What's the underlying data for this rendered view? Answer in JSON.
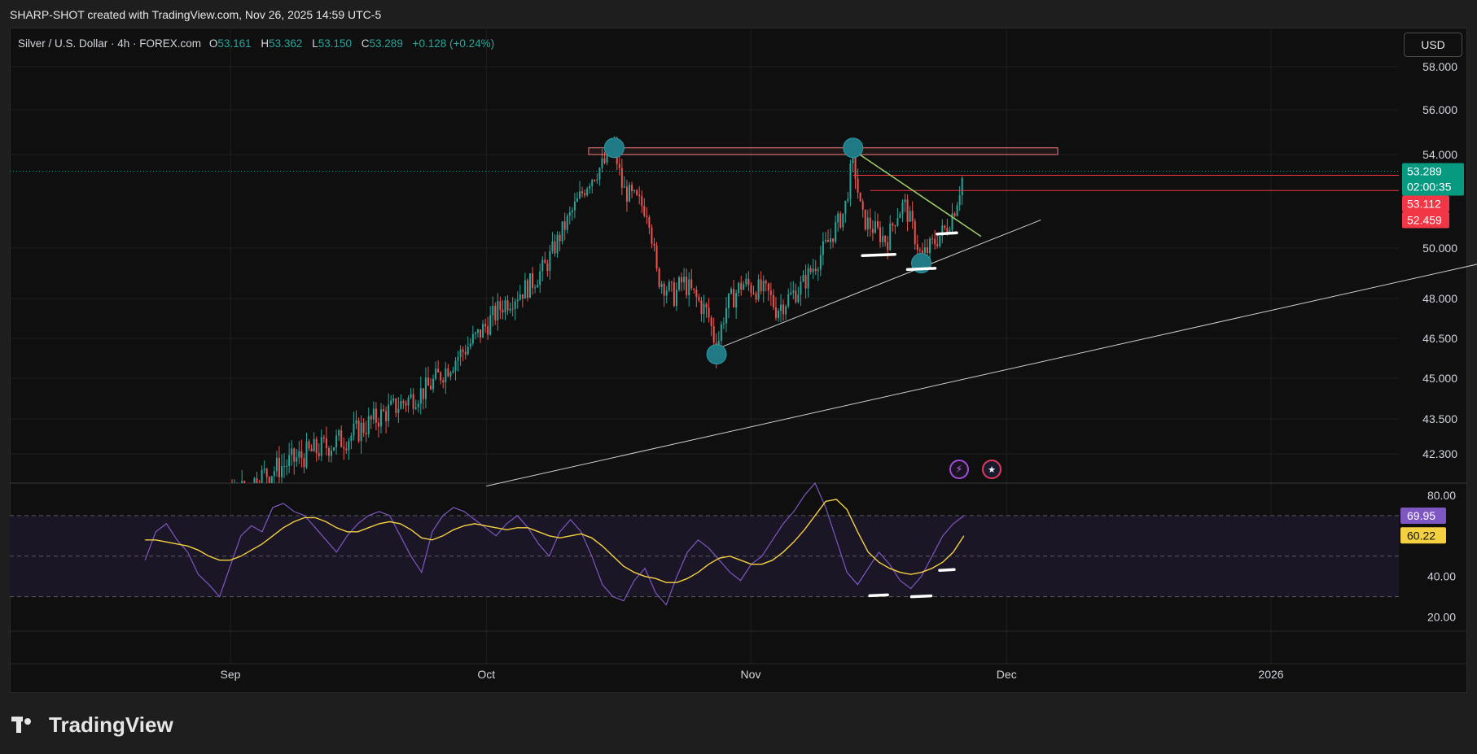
{
  "header": {
    "attribution": "SHARP-SHOT created with TradingView.com, Nov 26, 2025 14:59 UTC-5"
  },
  "legend": {
    "symbol": "Silver / U.S. Dollar · 4h · FOREX.com",
    "o_label": "O",
    "o_value": "53.161",
    "h_label": "H",
    "h_value": "53.362",
    "l_label": "L",
    "l_value": "53.150",
    "c_label": "C",
    "c_value": "53.289",
    "change": "+0.128 (+0.24%)"
  },
  "currency_button": "USD",
  "footer": {
    "brand": "TradingView"
  },
  "colors": {
    "bull": "#26a69a",
    "bear": "#ef5350",
    "rsi": "#7e57c2",
    "rsi_ma": "#f5d142",
    "resistance": "#f77c80",
    "price_badge": "#089981",
    "level_badge": "#f23645"
  },
  "icons": [
    "lightning-icon",
    "us-flag-icon"
  ],
  "chart_data": [
    {
      "type": "candlestick",
      "title": "Silver / U.S. Dollar",
      "timeframe": "4h",
      "x_ticks": [
        "Sep",
        "Oct",
        "Nov",
        "Dec",
        "2026"
      ],
      "y_ticks": [
        "58.000",
        "56.000",
        "54.000",
        "50.000",
        "48.000",
        "46.500",
        "45.000",
        "43.500",
        "42.300"
      ],
      "ylim": [
        41.5,
        58.5
      ],
      "price_path": [
        [
          "Aug 22",
          39.2
        ],
        [
          "Aug 29",
          39.6
        ],
        [
          "Sep 1",
          40.8
        ],
        [
          "Sep 5",
          41.6
        ],
        [
          "Sep 10",
          42.3
        ],
        [
          "Sep 15",
          42.9
        ],
        [
          "Sep 19",
          43.7
        ],
        [
          "Sep 24",
          44.6
        ],
        [
          "Sep 30",
          46.6
        ],
        [
          "Oct 3",
          47.8
        ],
        [
          "Oct 6",
          48.5
        ],
        [
          "Oct 8",
          49.3
        ],
        [
          "Oct 10",
          50.8
        ],
        [
          "Oct 13",
          52.9
        ],
        [
          "Oct 15",
          53.7
        ],
        [
          "Oct 16",
          54.3
        ],
        [
          "Oct 17",
          52.5
        ],
        [
          "Oct 20",
          51.6
        ],
        [
          "Oct 21",
          48.9
        ],
        [
          "Oct 23",
          48.1
        ],
        [
          "Oct 24",
          48.7
        ],
        [
          "Oct 27",
          47.4
        ],
        [
          "Oct 28",
          46.1
        ],
        [
          "Oct 29",
          47.6
        ],
        [
          "Oct 31",
          48.6
        ],
        [
          "Nov 3",
          48.2
        ],
        [
          "Nov 4",
          47.6
        ],
        [
          "Nov 6",
          48.2
        ],
        [
          "Nov 7",
          48.5
        ],
        [
          "Nov 10",
          50.2
        ],
        [
          "Nov 12",
          51.6
        ],
        [
          "Nov 13",
          53.9
        ],
        [
          "Nov 14",
          51.3
        ],
        [
          "Nov 17",
          50.3
        ],
        [
          "Nov 18",
          51.4
        ],
        [
          "Nov 19",
          51.9
        ],
        [
          "Nov 20",
          50.8
        ],
        [
          "Nov 21",
          49.6
        ],
        [
          "Nov 24",
          50.9
        ],
        [
          "Nov 25",
          51.8
        ],
        [
          "Nov 26",
          53.289
        ]
      ],
      "last_price": "53.289",
      "countdown": "02:00:35",
      "levels": [
        {
          "label": "53.112",
          "value": 53.112
        },
        {
          "label": "52.459",
          "value": 52.459
        }
      ],
      "resistance_zone": [
        54.0,
        54.3
      ],
      "trendlines": [
        {
          "name": "support",
          "from": [
            "Oct 28",
            46.1
          ],
          "to": [
            "Dec 5",
            51.2
          ]
        },
        {
          "name": "long support",
          "from": [
            "Oct 1",
            41.2
          ],
          "to": [
            "Jan 31",
            49.8
          ]
        },
        {
          "name": "downtrend",
          "from": [
            "Nov 13",
            54.2
          ],
          "to": [
            "Nov 28",
            50.5
          ]
        }
      ],
      "swing_points": [
        [
          "Oct 16",
          54.3
        ],
        [
          "Nov 13",
          54.3
        ],
        [
          "Oct 28",
          45.9
        ],
        [
          "Nov 21",
          49.4
        ]
      ]
    },
    {
      "type": "line",
      "title": "RSI",
      "y_ticks": [
        "80.00",
        "40.00",
        "20.00"
      ],
      "ylim": [
        13,
        86
      ],
      "bands": [
        30,
        70
      ],
      "rsi_value": "69.95",
      "ma_value": "60.22",
      "series": [
        {
          "values": [
            48,
            62,
            66,
            58,
            52,
            41,
            36,
            30,
            45,
            60,
            65,
            62,
            74,
            76,
            72,
            70,
            64,
            58,
            52,
            60,
            66,
            70,
            72,
            70,
            60,
            50,
            42,
            62,
            70,
            74,
            72,
            68,
            64,
            60,
            66,
            70,
            64,
            56,
            50,
            62,
            68,
            62,
            50,
            36,
            30,
            28,
            38,
            44,
            32,
            26,
            40,
            52,
            58,
            54,
            48,
            42,
            38,
            46,
            50,
            58,
            66,
            72,
            80,
            86,
            74,
            58,
            42,
            36,
            44,
            52,
            46,
            38,
            34,
            40,
            50,
            60,
            66,
            70
          ]
        },
        {
          "values": [
            58,
            58,
            57,
            56,
            55,
            53,
            50,
            48,
            48,
            50,
            53,
            56,
            60,
            64,
            67,
            69,
            69,
            67,
            64,
            62,
            62,
            64,
            66,
            67,
            66,
            63,
            59,
            58,
            60,
            63,
            65,
            66,
            65,
            64,
            63,
            64,
            64,
            62,
            60,
            59,
            60,
            61,
            59,
            55,
            50,
            45,
            42,
            40,
            39,
            37,
            37,
            39,
            42,
            46,
            49,
            50,
            48,
            46,
            46,
            48,
            52,
            57,
            63,
            70,
            77,
            78,
            73,
            62,
            52,
            47,
            44,
            42,
            41,
            42,
            44,
            47,
            52,
            60
          ]
        }
      ]
    }
  ]
}
